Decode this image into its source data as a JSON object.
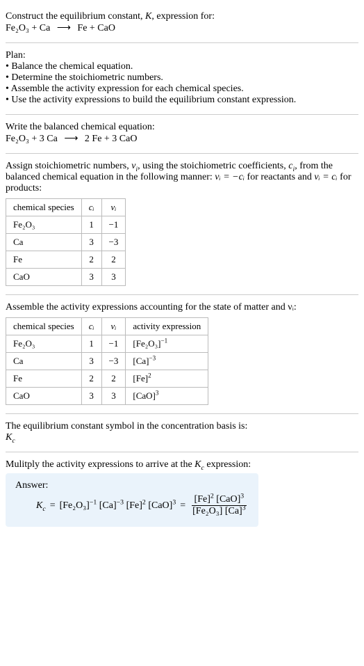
{
  "intro": {
    "prompt": "Construct the equilibrium constant, K, expression for:",
    "equation_lhs": "Fe₂O₃ + Ca",
    "arrow": "⟶",
    "equation_rhs": "Fe + CaO"
  },
  "plan": {
    "heading": "Plan:",
    "items": [
      "Balance the chemical equation.",
      "Determine the stoichiometric numbers.",
      "Assemble the activity expression for each chemical species.",
      "Use the activity expressions to build the equilibrium constant expression."
    ]
  },
  "balanced": {
    "heading": "Write the balanced chemical equation:",
    "lhs": "Fe₂O₃ + 3 Ca",
    "arrow": "⟶",
    "rhs": "2 Fe + 3 CaO"
  },
  "stoich": {
    "heading_pre": "Assign stoichiometric numbers, ",
    "nu": "ν",
    "heading_mid1": ", using the stoichiometric coefficients, ",
    "c": "c",
    "heading_mid2": ", from the balanced chemical equation in the following manner: ",
    "rel_react": "νᵢ = −cᵢ",
    "heading_mid3": " for reactants and ",
    "rel_prod": "νᵢ = cᵢ",
    "heading_end": " for products:",
    "headers": [
      "chemical species",
      "cᵢ",
      "νᵢ"
    ],
    "rows": [
      [
        "Fe₂O₃",
        "1",
        "−1"
      ],
      [
        "Ca",
        "3",
        "−3"
      ],
      [
        "Fe",
        "2",
        "2"
      ],
      [
        "CaO",
        "3",
        "3"
      ]
    ]
  },
  "activity": {
    "heading": "Assemble the activity expressions accounting for the state of matter and νᵢ:",
    "headers": [
      "chemical species",
      "cᵢ",
      "νᵢ",
      "activity expression"
    ],
    "rows": [
      {
        "sp": "Fe₂O₃",
        "c": "1",
        "nu": "−1",
        "base": "[Fe₂O₃]",
        "exp": "−1"
      },
      {
        "sp": "Ca",
        "c": "3",
        "nu": "−3",
        "base": "[Ca]",
        "exp": "−3"
      },
      {
        "sp": "Fe",
        "c": "2",
        "nu": "2",
        "base": "[Fe]",
        "exp": "2"
      },
      {
        "sp": "CaO",
        "c": "3",
        "nu": "3",
        "base": "[CaO]",
        "exp": "3"
      }
    ]
  },
  "eqsymbol": {
    "heading": "The equilibrium constant symbol in the concentration basis is:",
    "symbol_k": "K",
    "symbol_sub": "c"
  },
  "final": {
    "heading": "Mulitply the activity expressions to arrive at the K_c expression:",
    "answer_label": "Answer:",
    "kc_k": "K",
    "kc_sub": "c",
    "eq": "=",
    "term1_base": "[Fe₂O₃]",
    "term1_exp": "−1",
    "term2_base": "[Ca]",
    "term2_exp": "−3",
    "term3_base": "[Fe]",
    "term3_exp": "2",
    "term4_base": "[CaO]",
    "term4_exp": "3",
    "num1_base": "[Fe]",
    "num1_exp": "2",
    "num2_base": "[CaO]",
    "num2_exp": "3",
    "den1_base": "[Fe₂O₃]",
    "den1_exp": "",
    "den2_base": "[Ca]",
    "den2_exp": "3"
  },
  "chart_data": {
    "type": "table",
    "tables": [
      {
        "title": "Stoichiometric numbers",
        "headers": [
          "chemical species",
          "c_i",
          "nu_i"
        ],
        "rows": [
          [
            "Fe2O3",
            1,
            -1
          ],
          [
            "Ca",
            3,
            -3
          ],
          [
            "Fe",
            2,
            2
          ],
          [
            "CaO",
            3,
            3
          ]
        ]
      },
      {
        "title": "Activity expressions",
        "headers": [
          "chemical species",
          "c_i",
          "nu_i",
          "activity expression"
        ],
        "rows": [
          [
            "Fe2O3",
            1,
            -1,
            "[Fe2O3]^-1"
          ],
          [
            "Ca",
            3,
            -3,
            "[Ca]^-3"
          ],
          [
            "Fe",
            2,
            2,
            "[Fe]^2"
          ],
          [
            "CaO",
            3,
            3,
            "[CaO]^3"
          ]
        ]
      }
    ]
  }
}
